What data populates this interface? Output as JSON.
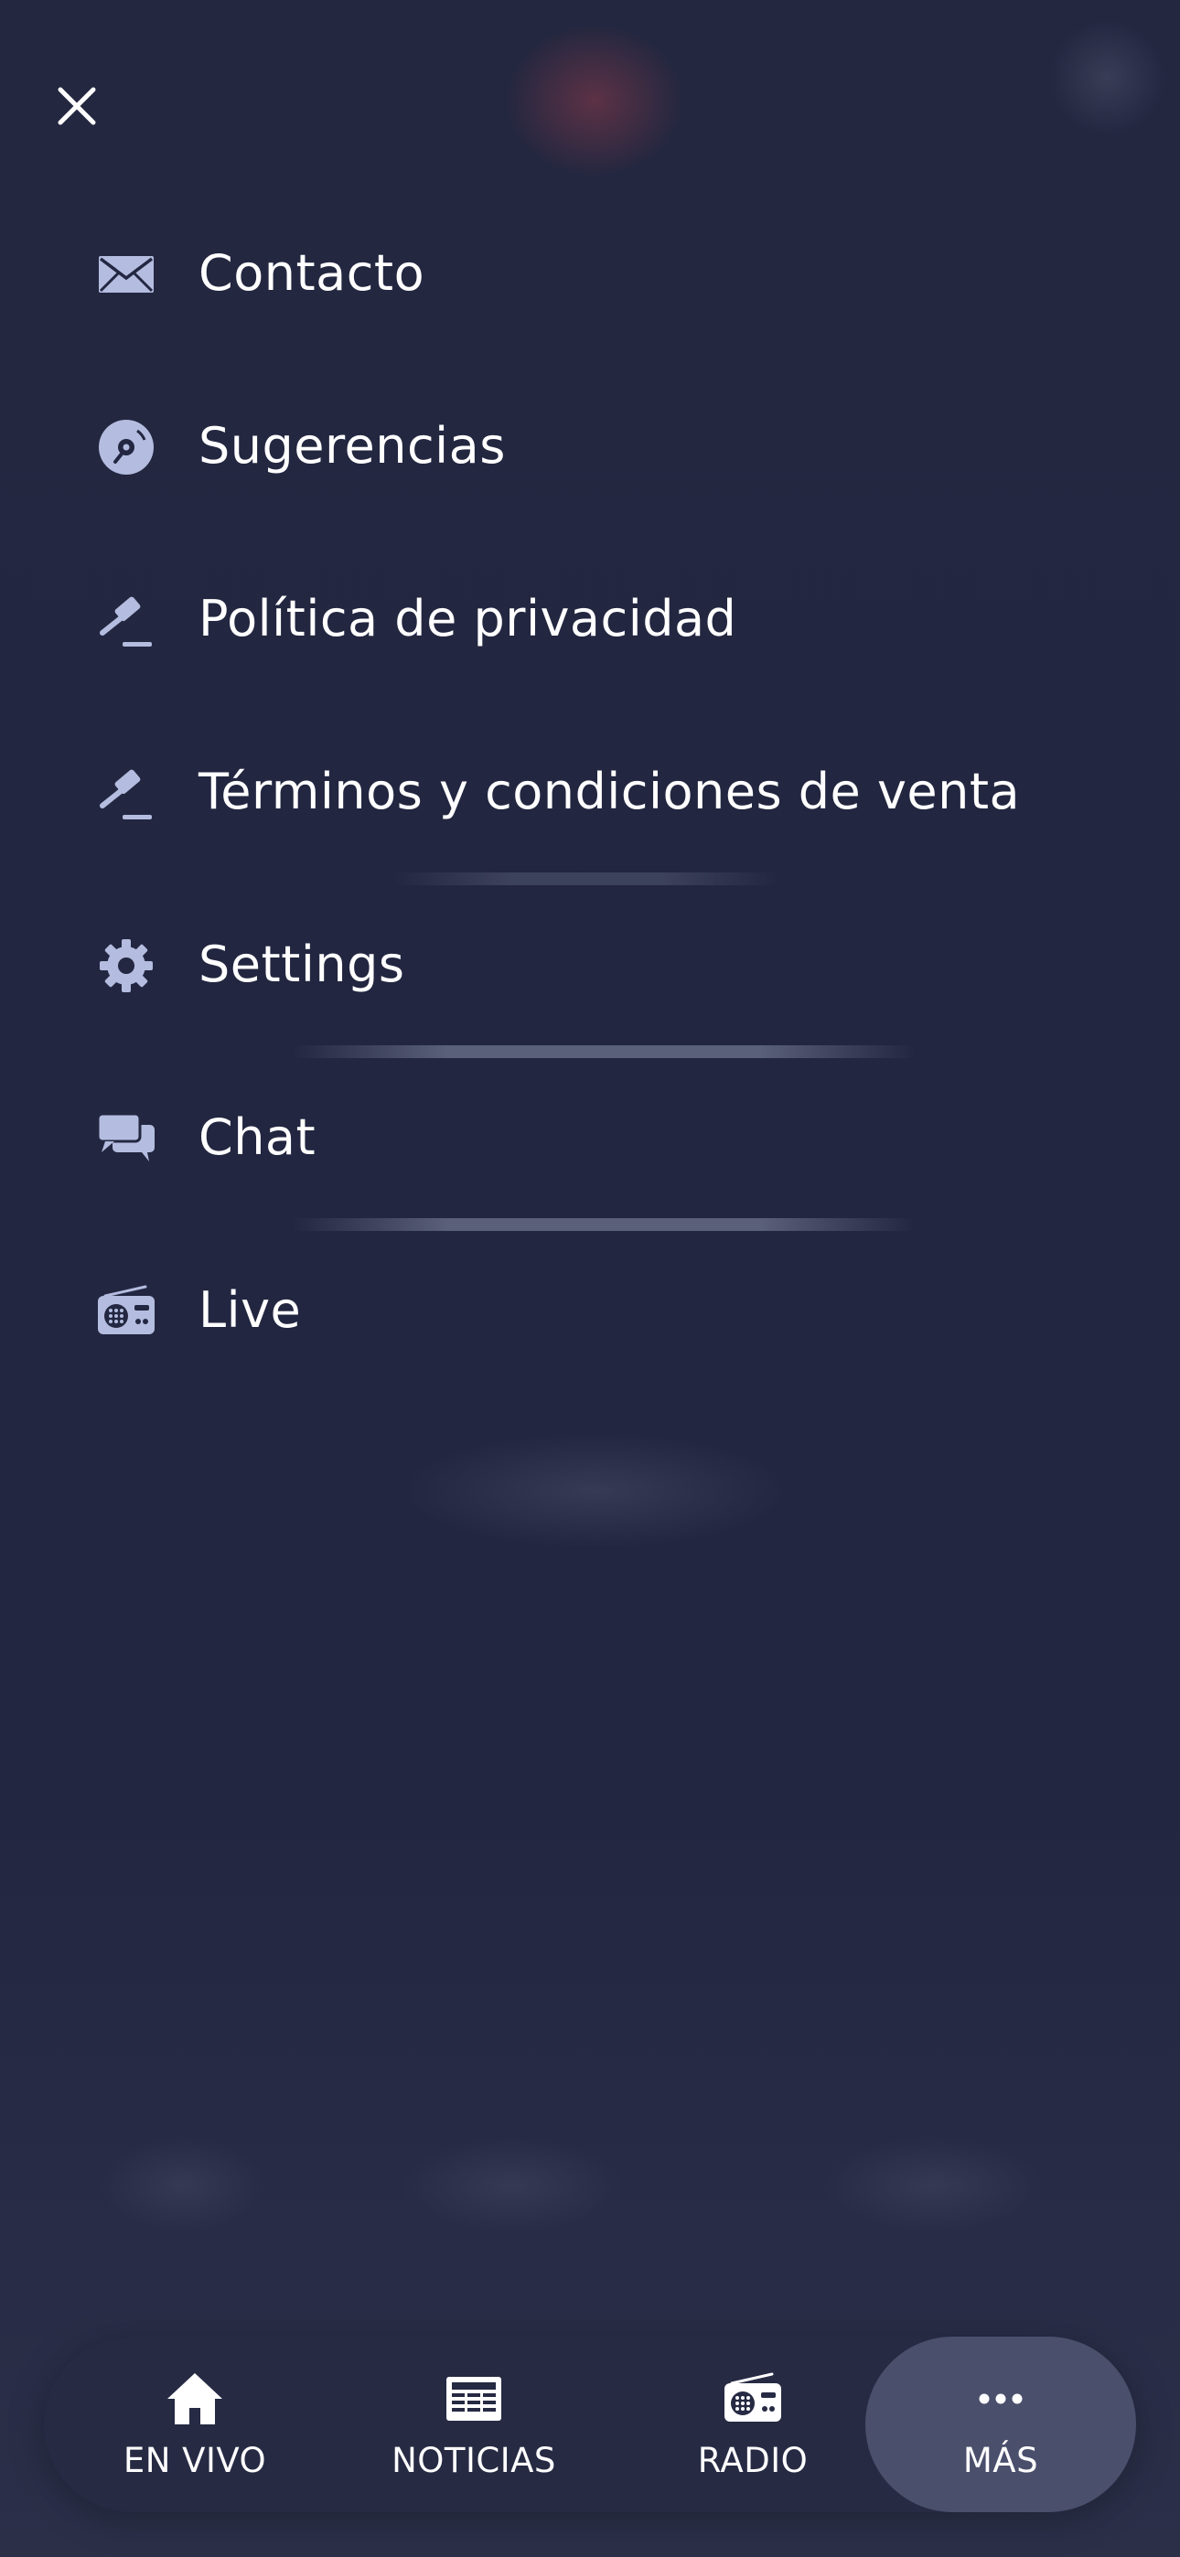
{
  "menu": {
    "close_icon": "close-icon",
    "items": [
      {
        "label": "Contacto",
        "icon": "envelope-icon"
      },
      {
        "label": "Sugerencias",
        "icon": "disc-icon"
      },
      {
        "label": "Política de privacidad",
        "icon": "gavel-icon"
      },
      {
        "label": "Términos y condiciones de venta",
        "icon": "gavel-icon"
      },
      {
        "label": "Settings",
        "icon": "gear-icon"
      },
      {
        "label": "Chat",
        "icon": "chat-bubbles-icon"
      },
      {
        "label": "Live",
        "icon": "radio-icon"
      }
    ]
  },
  "tabbar": {
    "tabs": [
      {
        "label": "EN VIVO",
        "icon": "home-icon",
        "active": false
      },
      {
        "label": "NOTICIAS",
        "icon": "newspaper-icon",
        "active": false
      },
      {
        "label": "RADIO",
        "icon": "radio-icon",
        "active": false
      },
      {
        "label": "MÁS",
        "icon": "more-dots-icon",
        "active": true
      }
    ]
  },
  "colors": {
    "background": "#232741",
    "icon": "#b4bddf",
    "text": "#ffffff",
    "tabbar": "#262a43",
    "tab_active": "#4a4f6c"
  }
}
